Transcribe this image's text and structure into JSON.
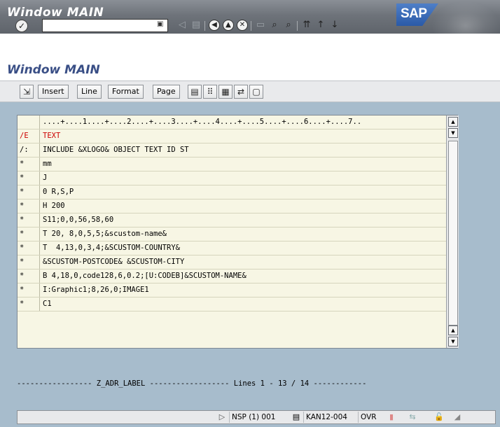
{
  "window": {
    "title": "Window MAIN",
    "logo_text": "SAP"
  },
  "system_toolbar": {
    "command_value": "",
    "icons": [
      "check-icon",
      "command-history-icon",
      "back-arrow-icon",
      "save-icon",
      "back-icon",
      "exit-icon",
      "cancel-icon",
      "print-icon",
      "find-icon",
      "find-next-icon",
      "first-page-icon",
      "prev-page-icon",
      "next-page-icon"
    ]
  },
  "screen": {
    "title": "Window MAIN"
  },
  "app_toolbar": {
    "buttons": [
      "Insert",
      "Line",
      "Format",
      "Page"
    ],
    "icons": [
      "choose-icon",
      "paste-icon",
      "windows-icon",
      "graphics-icon",
      "move-icon",
      "comment-icon"
    ]
  },
  "editor": {
    "ruler": "....+....1....+....2....+....3....+....4....+....5....+....6....+....7..",
    "rows": [
      {
        "fmt": "/E",
        "text": "TEXT"
      },
      {
        "fmt": "/:",
        "text": "INCLUDE &XLOGO& OBJECT TEXT ID ST"
      },
      {
        "fmt": "*",
        "text": "mm"
      },
      {
        "fmt": "*",
        "text": "J"
      },
      {
        "fmt": "*",
        "text": "0 R,S,P"
      },
      {
        "fmt": "*",
        "text": "H 200"
      },
      {
        "fmt": "*",
        "text": "S11;0,0,56,58,60"
      },
      {
        "fmt": "*",
        "text": "T 20, 8,0,5,5;&scustom-name&"
      },
      {
        "fmt": "*",
        "text": "T  4,13,0,3,4;&SCUSTOM-COUNTRY&"
      },
      {
        "fmt": "*",
        "text": "&SCUSTOM-POSTCODE& &SCUSTOM-CITY"
      },
      {
        "fmt": "*",
        "text": "B 4,18,0,code128,6,0.2;[U:CODEB]&SCUSTOM-NAME&"
      },
      {
        "fmt": "*",
        "text": "I:Graphic1;8,26,0;IMAGE1"
      },
      {
        "fmt": "*",
        "text": "C1"
      }
    ]
  },
  "footer": {
    "status_line": "----------------- Z_ADR_LABEL ------------------ Lines 1 - 13 / 14 ------------"
  },
  "status_bar": {
    "system": "NSP (1) 001",
    "server": "KAN12-004",
    "mode": "OVR"
  },
  "colors": {
    "background": "#a7bccc",
    "editor_bg": "#f7f6e4",
    "title_blue": "#3a4f86",
    "red_text": "#cc0000"
  }
}
